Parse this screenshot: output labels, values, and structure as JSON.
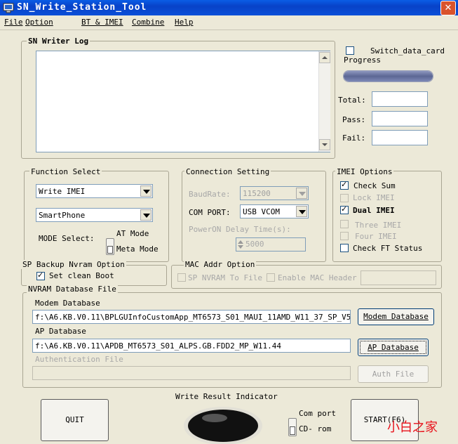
{
  "window": {
    "title": "SN_Write_Station_Tool",
    "close": "✕"
  },
  "menu": [
    "File",
    "Option",
    "BT & IMEI",
    "Combine",
    "Help"
  ],
  "log": {
    "title": "SN Writer Log"
  },
  "switch_data_card": "Switch_data_card",
  "progress": {
    "label": "Progress",
    "value": 1.0
  },
  "stats": {
    "total": "Total:",
    "pass": "Pass:",
    "fail": "Fail:"
  },
  "function_select": {
    "title": "Function Select",
    "write_value": "Write IMEI",
    "target_value": "SmartPhone",
    "mode_label": "MODE Select:",
    "at_mode": "AT Mode",
    "meta_mode": "Meta Mode"
  },
  "connection": {
    "title": "Connection Setting",
    "baud_label": "BaudRate:",
    "baud_value": "115200",
    "com_label": "COM PORT:",
    "com_value": "USB VCOM",
    "delay_label": "PowerON Delay Time(s):",
    "delay_value": "5000"
  },
  "imei_options": {
    "title": "IMEI Options",
    "check_sum": "Check Sum",
    "lock_imei": "Lock IMEI",
    "dual_imei": "Dual IMEI",
    "three_imei": "Three IMEI",
    "four_imei": "Four IMEI",
    "check_ft": "Check FT Status"
  },
  "sp_backup": {
    "title": "SP Backup Nvram Option",
    "clean_boot": "Set clean Boot"
  },
  "mac": {
    "title": "MAC Addr Option",
    "sp_nvram": "SP NVRAM To File",
    "enable_mac": "Enable MAC Header"
  },
  "nvram": {
    "title": "NVRAM Database File",
    "modem_label": "Modem Database",
    "modem_path": "f:\\A6.KB.V0.11\\BPLGUInfoCustomApp_MT6573_S01_MAUI_11AMD_W11_37_SP_V5",
    "modem_button": "Modem Database",
    "ap_label": "AP Database",
    "ap_path": "f:\\A6.KB.V0.11\\APDB_MT6573_S01_ALPS.GB.FDD2_MP_W11.44",
    "ap_button": "AP Database",
    "auth_label": "Authentication File",
    "auth_button": "Auth File"
  },
  "bottom": {
    "quit": "QUIT",
    "indicator_label": "Write Result Indicator",
    "com_port": "Com port",
    "cd_rom": "CD- rom",
    "start": "START(F6)",
    "watermark": "小白之家"
  }
}
